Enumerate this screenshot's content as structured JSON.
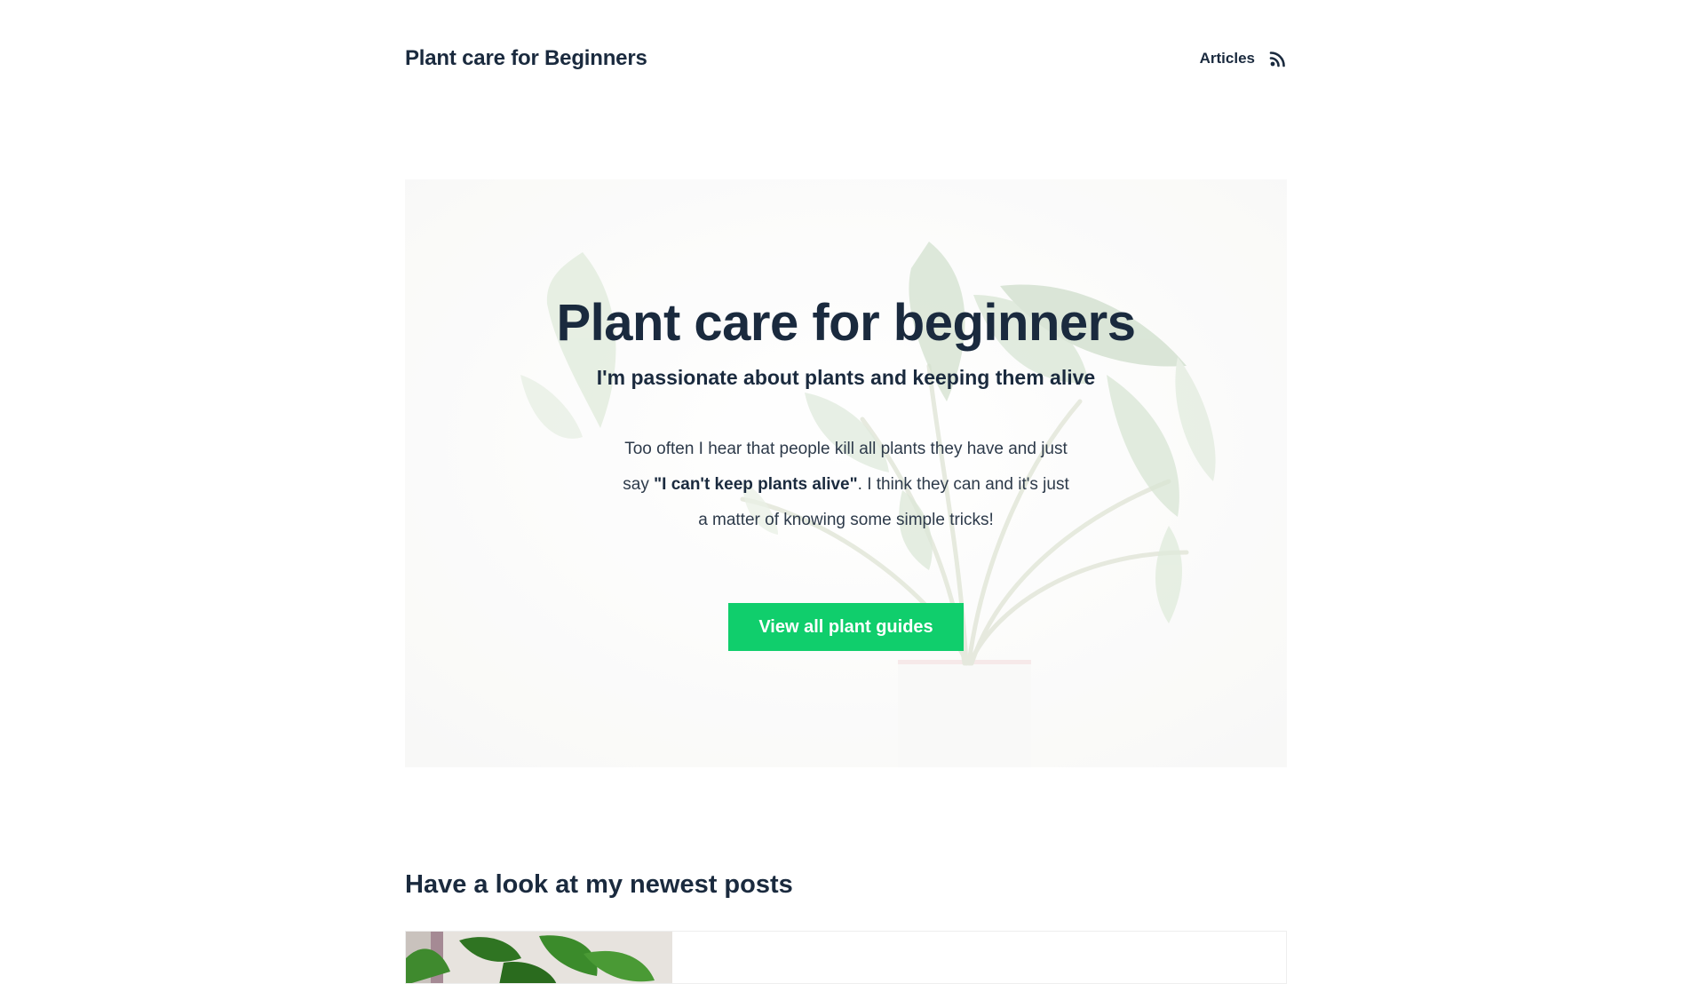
{
  "header": {
    "site_title": "Plant care for Beginners",
    "nav": {
      "articles_label": "Articles",
      "rss_icon": "rss-icon"
    }
  },
  "hero": {
    "title": "Plant care for beginners",
    "subtitle": "I'm passionate about plants and keeping them alive",
    "text_before": "Too often I hear that people kill all plants they have and just say ",
    "text_bold": "\"I can't keep plants alive\"",
    "text_after": ". I think they can and it's just a matter of knowing some simple tricks!",
    "cta_label": "View all plant guides",
    "background_image": "plant-illustration"
  },
  "newest_posts": {
    "heading": "Have a look at my newest posts"
  },
  "colors": {
    "text_dark": "#1a2a3e",
    "accent_green": "#10ce6c",
    "background": "#ffffff"
  }
}
